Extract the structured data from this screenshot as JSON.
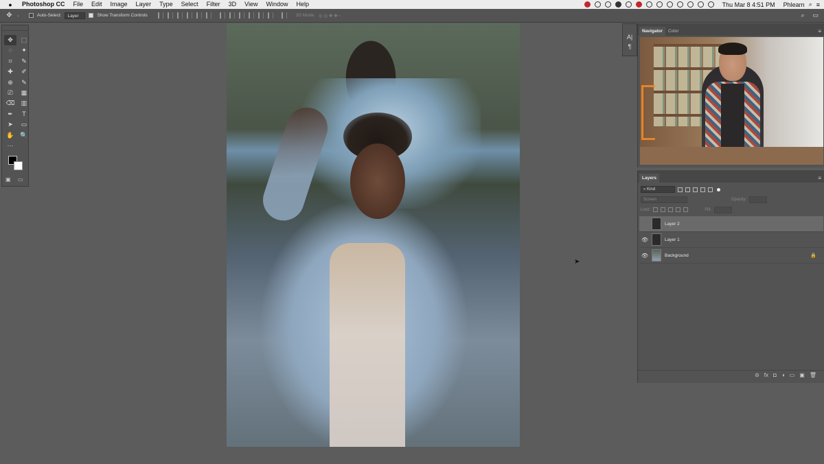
{
  "menubar": {
    "apple": "",
    "app_name": "Photoshop CC",
    "menus": [
      "File",
      "Edit",
      "Image",
      "Layer",
      "Type",
      "Select",
      "Filter",
      "3D",
      "View",
      "Window",
      "Help"
    ],
    "clock": "Thu Mar 8  4:51 PM",
    "user": "Phlearn",
    "search_icon": "⌕",
    "list_icon": "≡"
  },
  "options": {
    "auto_select_label": "Auto-Select:",
    "auto_select_value": "Layer",
    "show_transform_label": "Show Transform Controls",
    "mode_3d": "3D Mode:",
    "move_icon": "✥",
    "search_icon": "⌕",
    "workspace_icon": "▭"
  },
  "tools": [
    "✥",
    "⬚",
    "◌",
    "✦",
    "⌗",
    "✎",
    "✚",
    "✐",
    "⊕",
    "✎",
    "⎚",
    "▦",
    "⌫",
    "▥",
    "💧",
    "◐",
    "✒",
    "T",
    "➤",
    "▭",
    "✋",
    "🔍",
    "···",
    ""
  ],
  "mini_panel": {
    "char": "A|",
    "para": "¶"
  },
  "navigator": {
    "tabs": [
      "Navigator",
      "Color"
    ],
    "menu_icon": "≡"
  },
  "layers": {
    "title": "Layers",
    "menu_icon": "≡",
    "filter_label": "⌕ Kind",
    "blend_mode": "Screen",
    "opacity_label": "Opacity:",
    "lock_label": "Lock:",
    "fill_label": "Fill:",
    "items": [
      {
        "name": "Layer 2",
        "visible": false,
        "selected": true
      },
      {
        "name": "Layer 1",
        "visible": true,
        "selected": false
      },
      {
        "name": "Background",
        "visible": true,
        "selected": false,
        "locked": true
      }
    ],
    "eye_icon": "👁",
    "lock_icon": "🔒",
    "footer_icons": [
      "⊝",
      "fx",
      "◘",
      "◑",
      "▭",
      "▣",
      "🗑"
    ]
  },
  "colors": {
    "menubar": "#ececec",
    "ui_dark": "#535353",
    "canvas_bg": "#5c5c5c",
    "selected_layer": "#6a6a6a"
  }
}
